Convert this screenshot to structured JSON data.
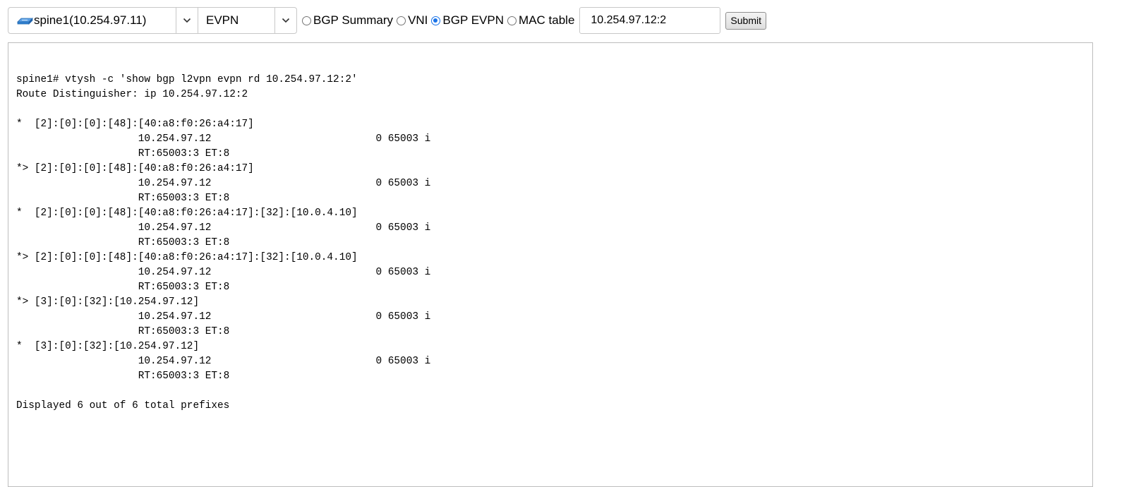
{
  "toolbar": {
    "node_select": {
      "value": "spine1(10.254.97.11)",
      "icon": "router-icon"
    },
    "command_select": {
      "value": "EVPN"
    },
    "radios": [
      {
        "label": "BGP Summary",
        "checked": false
      },
      {
        "label": "VNI",
        "checked": false
      },
      {
        "label": "BGP EVPN",
        "checked": true
      },
      {
        "label": "MAC table",
        "checked": false
      }
    ],
    "rd_input": {
      "value": "10.254.97.12:2"
    },
    "submit_label": "Submit"
  },
  "output": {
    "text": "spine1# vtysh -c 'show bgp l2vpn evpn rd 10.254.97.12:2'\nRoute Distinguisher: ip 10.254.97.12:2\n\n*  [2]:[0]:[0]:[48]:[40:a8:f0:26:a4:17]\n                    10.254.97.12                           0 65003 i\n                    RT:65003:3 ET:8\n*> [2]:[0]:[0]:[48]:[40:a8:f0:26:a4:17]\n                    10.254.97.12                           0 65003 i\n                    RT:65003:3 ET:8\n*  [2]:[0]:[0]:[48]:[40:a8:f0:26:a4:17]:[32]:[10.0.4.10]\n                    10.254.97.12                           0 65003 i\n                    RT:65003:3 ET:8\n*> [2]:[0]:[0]:[48]:[40:a8:f0:26:a4:17]:[32]:[10.0.4.10]\n                    10.254.97.12                           0 65003 i\n                    RT:65003:3 ET:8\n*> [3]:[0]:[32]:[10.254.97.12]\n                    10.254.97.12                           0 65003 i\n                    RT:65003:3 ET:8\n*  [3]:[0]:[32]:[10.254.97.12]\n                    10.254.97.12                           0 65003 i\n                    RT:65003:3 ET:8\n\nDisplayed 6 out of 6 total prefixes"
  },
  "colors": {
    "radio_accent": "#1a73e8",
    "border": "#c8c8c8"
  }
}
